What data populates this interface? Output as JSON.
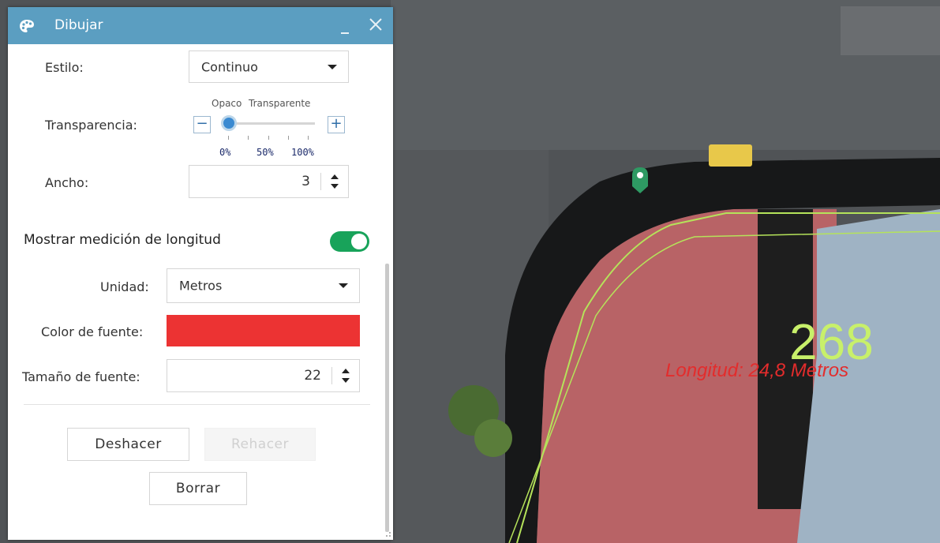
{
  "window": {
    "title": "Dibujar",
    "title_icon": "palette-icon",
    "accent": "#5b9ec1"
  },
  "style": {
    "label": "Estilo:",
    "value": "Continuo"
  },
  "transparency": {
    "label": "Transparencia:",
    "opaque_label": "Opaco",
    "transparent_label": "Transparente",
    "minus": "−",
    "plus": "+",
    "value_percent": 0,
    "ticks": [
      "0%",
      "50%",
      "100%"
    ]
  },
  "width": {
    "label": "Ancho:",
    "value": "3"
  },
  "measure": {
    "title": "Mostrar medición de longitud",
    "enabled": true,
    "toggle_color": "#18a35a",
    "unit_label": "Unidad:",
    "unit_value": "Metros",
    "font_color_label": "Color de fuente:",
    "font_color": "#ec3333",
    "font_size_label": "Tamaño de fuente:",
    "font_size_value": "22"
  },
  "actions": {
    "undo": "Deshacer",
    "redo": "Rehacer",
    "clear": "Borrar"
  },
  "map": {
    "label_number": "268",
    "length_label": "Longitud: 24,8 Metros",
    "line_color": "#b5e35a"
  }
}
